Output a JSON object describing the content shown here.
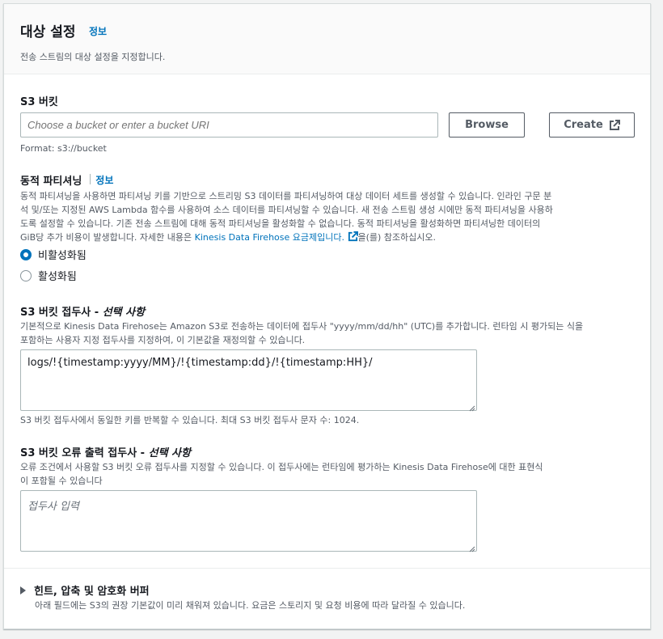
{
  "header": {
    "title": "대상 설정",
    "info": "정보",
    "description": "전송 스트림의 대상 설정을 지정합니다."
  },
  "s3_bucket": {
    "label": "S3 버킷",
    "placeholder": "Choose a bucket or enter a bucket URI",
    "browse_label": "Browse",
    "create_label": "Create",
    "format_hint": "Format: s3://bucket"
  },
  "dynamic_partitioning": {
    "label": "동적 파티셔닝",
    "info": "정보",
    "desc_line1": "동적 파티셔닝을 사용하면 파티셔닝 키를 기반으로 스트리밍 S3 데이터를 파티셔닝하여 대상 데이터 세트를 생성할 수 있습니다. 인라인 구문 분",
    "desc_line2": "석 및/또는 지정된 AWS Lambda 함수를 사용하여 소스 데이터를 파티셔닝할 수 있습니다. 새 전송 스트림 생성 시에만 동적 파티셔닝을 사용하",
    "desc_line3": "도록 설정할 수 있습니다. 기존 전송 스트림에 대해 동적 파티셔닝을 활성화할 수 없습니다. 동적 파티셔닝을 활성화하면 파티셔닝한 데이터의",
    "desc_line4_pre": "GiB당 추가 비용이 발생합니다. 자세한 내용은 ",
    "desc_link": "Kinesis Data Firehose 요금제입니다.",
    "desc_line4_post": "을(를) 참조하십시오.",
    "options": [
      {
        "label": "비활성화됨",
        "selected": true
      },
      {
        "label": "활성화됨",
        "selected": false
      }
    ]
  },
  "prefix": {
    "label": "S3 버킷 접두사 - ",
    "optional": "선택 사항",
    "desc_line1": "기본적으로 Kinesis Data Firehose는 Amazon S3로 전송하는 데이터에 접두사 \"yyyy/mm/dd/hh\" (UTC)를 추가합니다. 런타임 시 평가되는 식을",
    "desc_line2": "포함하는 사용자 지정 접두사를 지정하여, 이 기본값을 재정의할 수 있습니다.",
    "value": "logs/!{timestamp:yyyy/MM}/!{timestamp:dd}/!{timestamp:HH}/",
    "hint": "S3 버킷 접두사에서 동일한 키를 반복할 수 있습니다. 최대 S3 버킷 접두사 문자 수: 1024."
  },
  "error_prefix": {
    "label": "S3 버킷 오류 출력 접두사 - ",
    "optional": "선택 사항",
    "desc_line1": "오류 조건에서 사용할 S3 버킷 오류 접두사를 지정할 수 있습니다. 이 접두사에는 런타임에 평가하는 Kinesis Data Firehose에 대한 표현식",
    "desc_line2": "이 포함될 수 있습니다",
    "placeholder": "접두사 입력"
  },
  "buffer_section": {
    "title": "힌트, 압축 및 암호화 버퍼",
    "description": "아래 필드에는 S3의 권장 기본값이 미리 채워져 있습니다. 요금은 스토리지 및 요청 비용에 따라 달라질 수 있습니다."
  },
  "colors": {
    "link": "#0073bb",
    "text": "#16191f",
    "secondary": "#545b64",
    "border": "#aab7b8"
  }
}
